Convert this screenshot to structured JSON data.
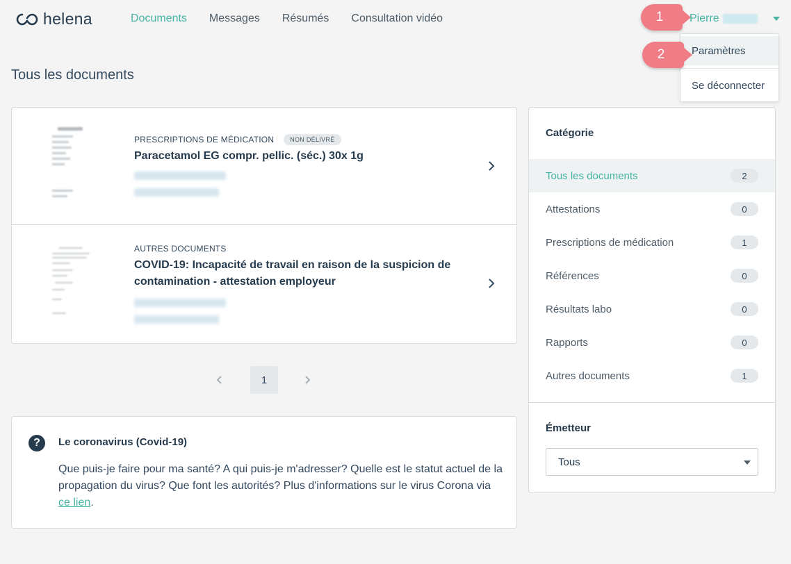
{
  "brand": {
    "name": "helena"
  },
  "nav": {
    "items": [
      {
        "label": "Documents"
      },
      {
        "label": "Messages"
      },
      {
        "label": "Résumés"
      },
      {
        "label": "Consultation vidéo"
      }
    ]
  },
  "user": {
    "first_name": "Pierre"
  },
  "dropdown": {
    "items": [
      {
        "label": "Paramètres"
      },
      {
        "label": "Se déconnecter"
      }
    ]
  },
  "callouts": [
    {
      "number": "1"
    },
    {
      "number": "2"
    }
  ],
  "page": {
    "title": "Tous les documents"
  },
  "documents": [
    {
      "category": "PRESCRIPTIONS DE MÉDICATION",
      "badge": "NON DÉLIVRÉ",
      "title": "Paracetamol EG compr. pellic. (séc.) 30x 1g"
    },
    {
      "category": "AUTRES DOCUMENTS",
      "title": "COVID-19: Incapacité de travail en raison de la suspicion de contamination - attestation employeur"
    }
  ],
  "pagination": {
    "current": "1"
  },
  "covid": {
    "title": "Le coronavirus (Covid-19)",
    "body": "Que puis-je faire pour ma santé? A qui puis-je m'adresser? Quelle est le statut actuel de la propagation du virus? Que font les autorités? Plus d'informations sur le virus Corona via ",
    "link_label": "ce lien",
    "suffix": "."
  },
  "sidebar": {
    "category_heading": "Catégorie",
    "categories": [
      {
        "label": "Tous les documents",
        "count": "2"
      },
      {
        "label": "Attestations",
        "count": "0"
      },
      {
        "label": "Prescriptions de médication",
        "count": "1"
      },
      {
        "label": "Références",
        "count": "0"
      },
      {
        "label": "Résultats labo",
        "count": "0"
      },
      {
        "label": "Rapports",
        "count": "0"
      },
      {
        "label": "Autres documents",
        "count": "1"
      }
    ],
    "emitter_heading": "Émetteur",
    "emitter_value": "Tous"
  },
  "colors": {
    "accent": "#46b3a3",
    "dark": "#263b4d",
    "callout": "#f07c86"
  }
}
